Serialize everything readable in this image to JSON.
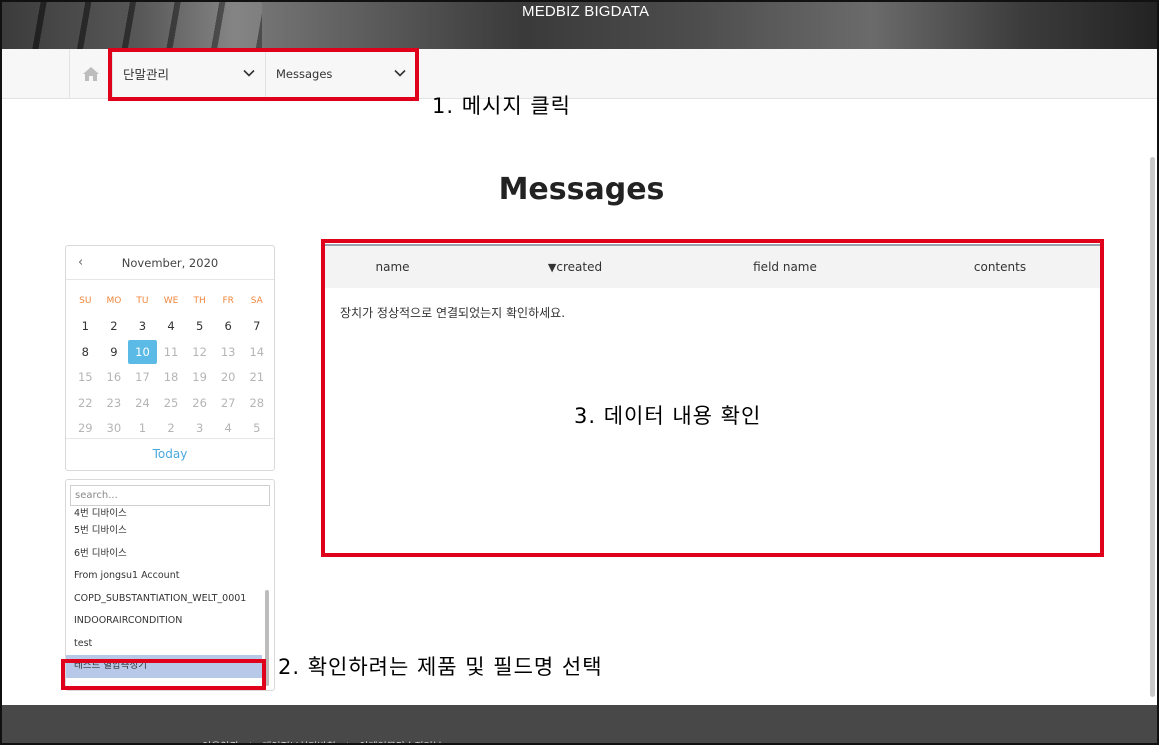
{
  "header": {
    "brand": "MEDBIZ BIGDATA"
  },
  "nav": {
    "menu1": "단말관리",
    "menu2": "Messages"
  },
  "annotations": {
    "step1": "1. 메시지 클릭",
    "step2": "2. 확인하려는 제품 및 필드명 선택",
    "step3": "3. 데이터 내용 확인"
  },
  "page": {
    "title": "Messages"
  },
  "calendar": {
    "month_label": "November, 2020",
    "weekdays": [
      "SU",
      "MO",
      "TU",
      "WE",
      "TH",
      "FR",
      "SA"
    ],
    "weeks": [
      [
        "1",
        "2",
        "3",
        "4",
        "5",
        "6",
        "7"
      ],
      [
        "8",
        "9",
        "10",
        "11",
        "12",
        "13",
        "14"
      ],
      [
        "15",
        "16",
        "17",
        "18",
        "19",
        "20",
        "21"
      ],
      [
        "22",
        "23",
        "24",
        "25",
        "26",
        "27",
        "28"
      ],
      [
        "29",
        "30",
        "1",
        "2",
        "3",
        "4",
        "5"
      ]
    ],
    "selected_day": "10",
    "today_label": "Today"
  },
  "devices": {
    "search_placeholder": "search...",
    "items": [
      "4번 디바이스",
      "5번 디바이스",
      "6번 디바이스",
      "From jongsu1 Account",
      "COPD_SUBSTANTIATION_WELT_0001",
      "INDOORAIRCONDITION",
      "test",
      "테스트 혈압측정기"
    ],
    "selected_item": "테스트 혈압측정기"
  },
  "table": {
    "columns": [
      "name",
      "created",
      "field name",
      "contents"
    ],
    "sort_indicator": "▼",
    "empty_message": "장치가 정상적으로 연결되었는지 확인하세요."
  },
  "footer": {
    "links": [
      "이용약관",
      "|",
      "개인정보처리방침",
      "|",
      "이메일무단수집거부"
    ]
  },
  "colors": {
    "annotation_box": "#e0001b",
    "calendar_selected": "#5bbbe6",
    "weekday_header": "#f0863b",
    "today_link": "#4aa8de",
    "list_selected": "#b8c8e8",
    "footer_bg": "#484848"
  }
}
